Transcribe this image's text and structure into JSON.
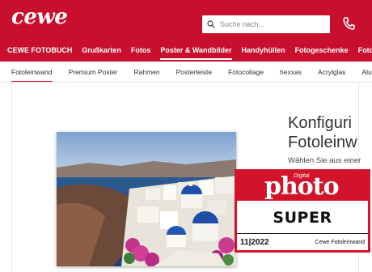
{
  "header": {
    "logo": "cewe",
    "search_placeholder": "Suche nach...",
    "brand_color": "#c8102e"
  },
  "categories": [
    {
      "label": "CEWE FOTOBUCH",
      "active": false
    },
    {
      "label": "Grußkarten",
      "active": false
    },
    {
      "label": "Fotos",
      "active": false
    },
    {
      "label": "Poster & Wandbilder",
      "active": true
    },
    {
      "label": "Handyhüllen",
      "active": false
    },
    {
      "label": "Fotogeschenke",
      "active": false
    },
    {
      "label": "Fotokalend",
      "active": false
    }
  ],
  "subnav": [
    {
      "label": "Fotoleinwand",
      "active": true
    },
    {
      "label": "Premium Poster",
      "active": false
    },
    {
      "label": "Rahmen",
      "active": false
    },
    {
      "label": "Posterleiste",
      "active": false
    },
    {
      "label": "Fotocollage",
      "active": false
    },
    {
      "label": "hexxas",
      "active": false
    },
    {
      "label": "Acrylglas",
      "active": false
    },
    {
      "label": "Alu-Dibond",
      "active": false
    }
  ],
  "main": {
    "headline_line1": "Konfiguri",
    "headline_line2": "Fotoleinw",
    "subline": "Wählen Sie aus einer"
  },
  "badge": {
    "digital": "Digital",
    "photo": "photo",
    "rating": "SUPER",
    "date": "11|2022",
    "product": "Cewe Fotoleinwand",
    "color": "#d2142a"
  }
}
